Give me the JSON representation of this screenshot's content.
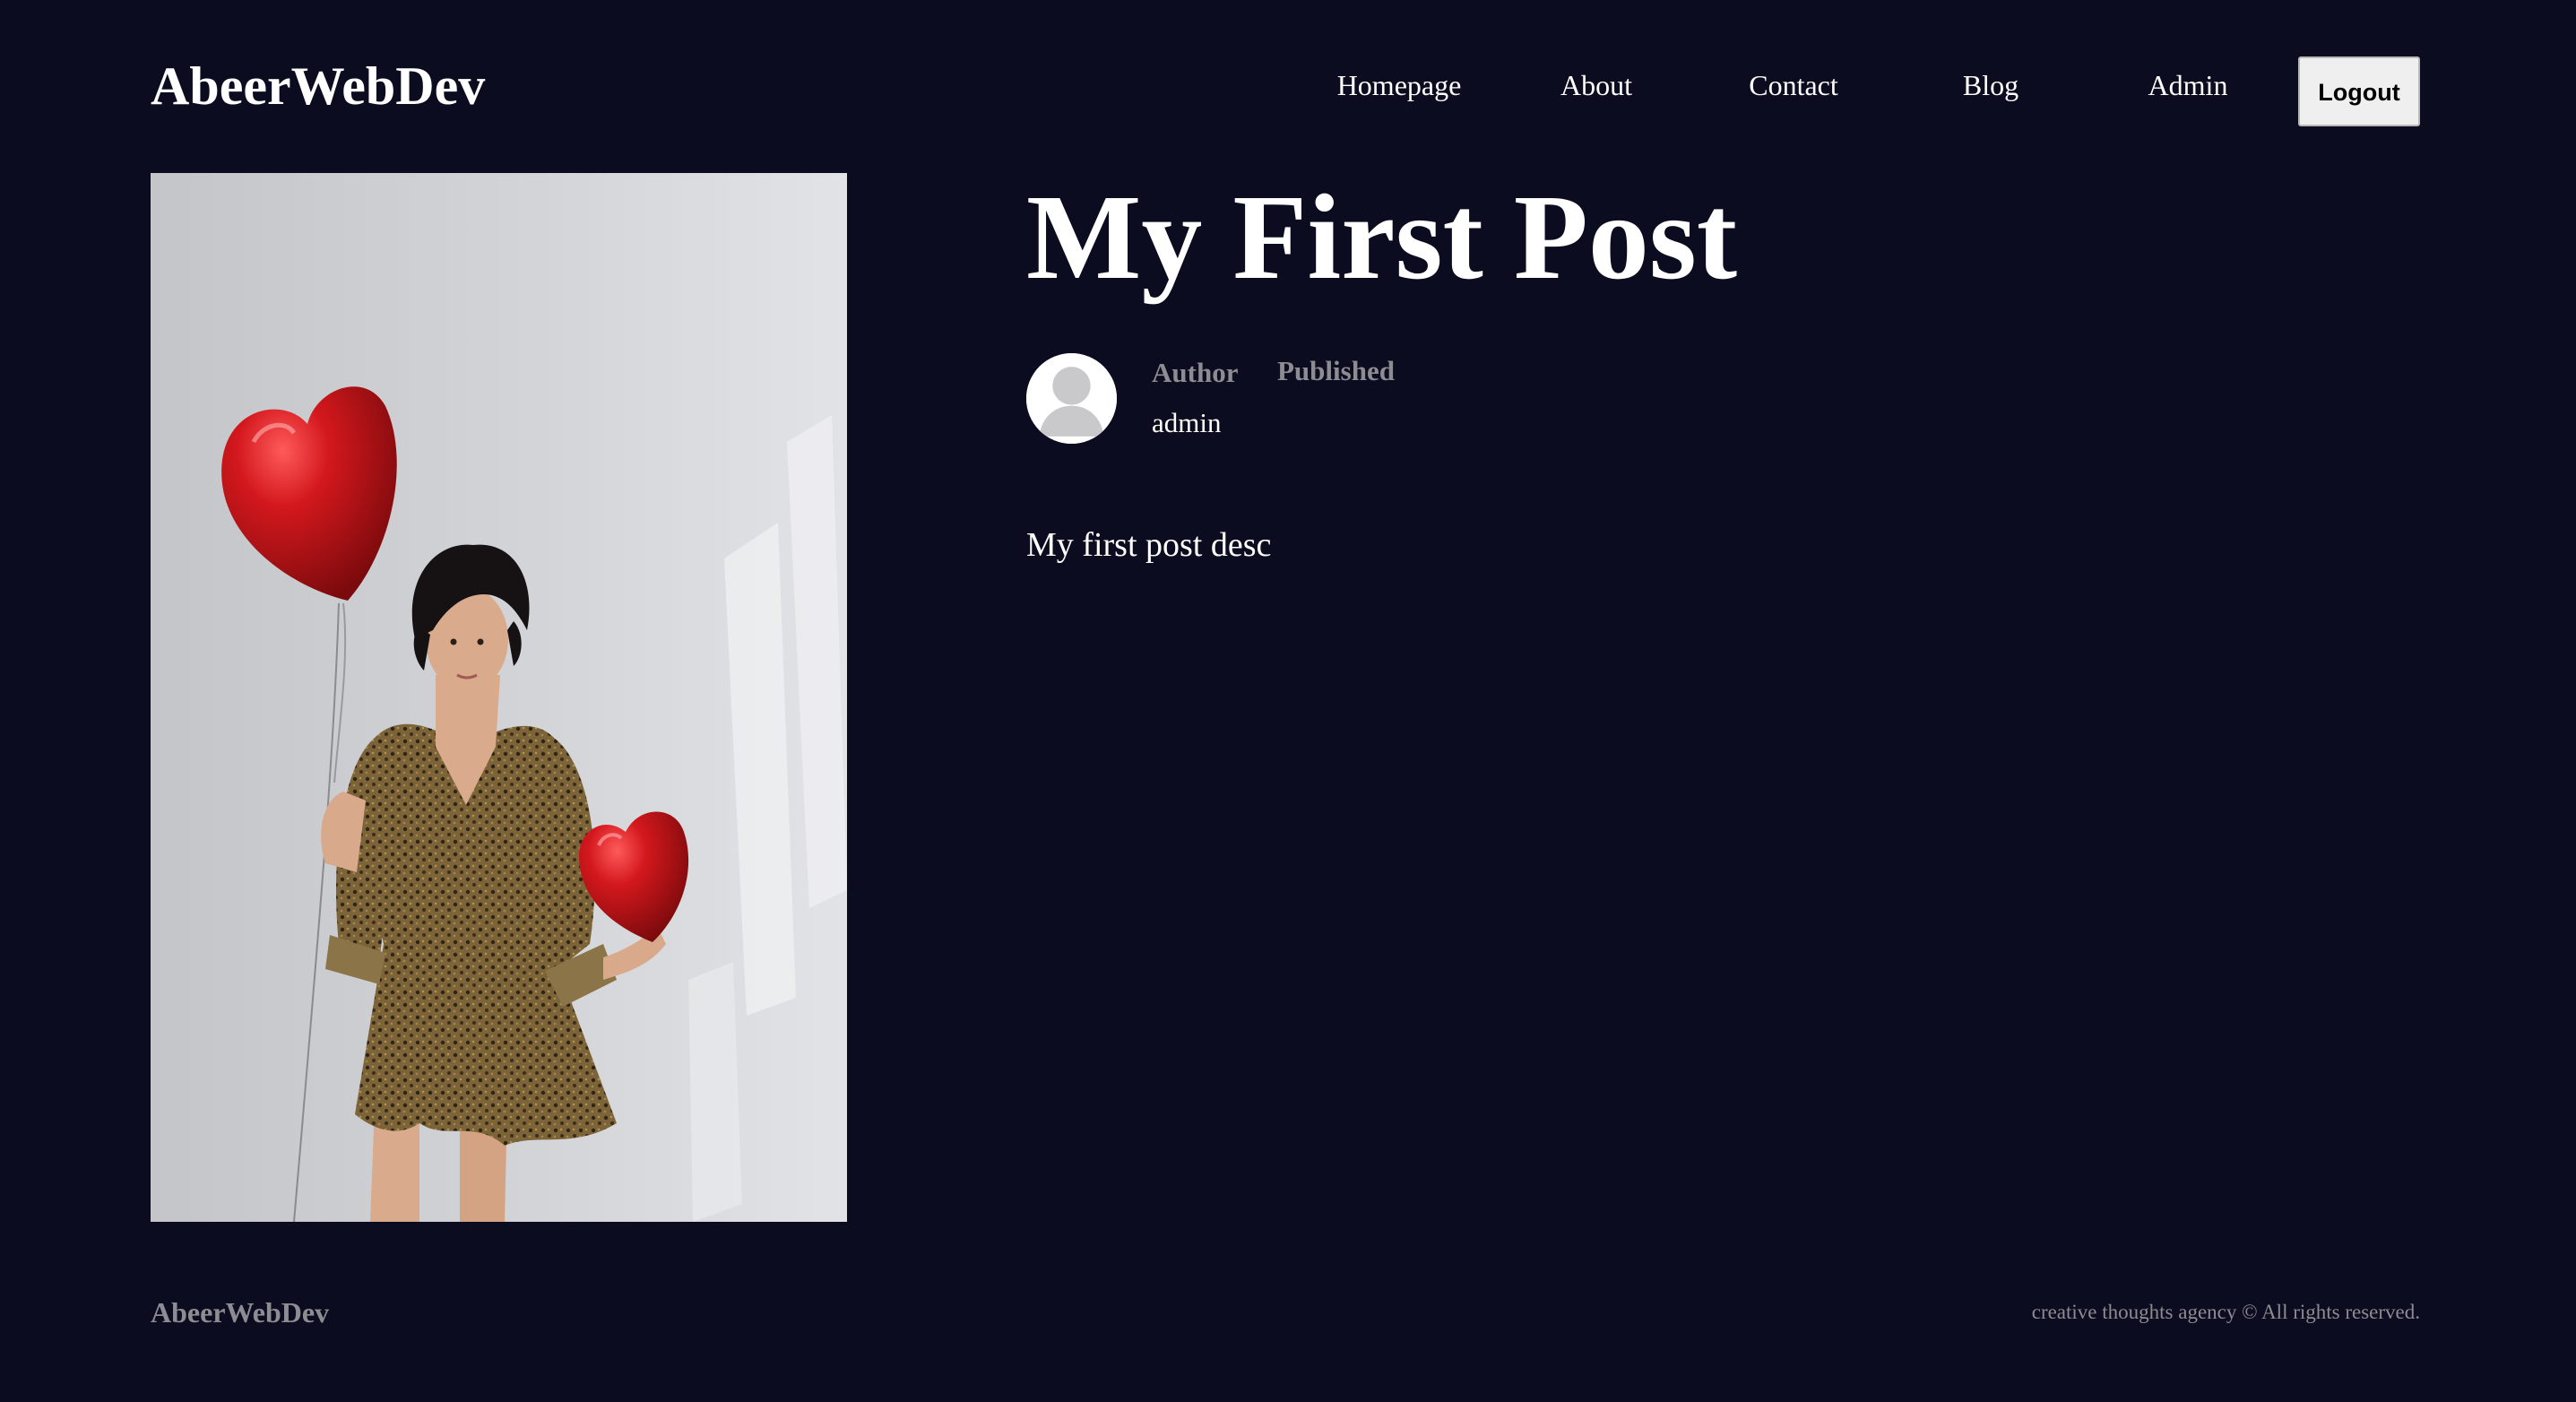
{
  "navbar": {
    "logo": "AbeerWebDev",
    "links": [
      {
        "label": "Homepage"
      },
      {
        "label": "About"
      },
      {
        "label": "Contact"
      },
      {
        "label": "Blog"
      },
      {
        "label": "Admin"
      }
    ],
    "logout_label": "Logout"
  },
  "post": {
    "image_icon": "woman-with-heart-balloons-photo",
    "title": "My First Post",
    "avatar_icon": "user-avatar-icon",
    "author_label": "Author",
    "author_name": "admin",
    "published_label": "Published",
    "description": "My first post desc"
  },
  "footer": {
    "logo": "AbeerWebDev",
    "copyright": "creative thoughts agency © All rights reserved."
  },
  "colors": {
    "background": "#0b0c1f",
    "text": "#ffffff",
    "muted": "#8c8c93",
    "button_bg": "#efefef",
    "balloon_red": "#c8151b"
  }
}
